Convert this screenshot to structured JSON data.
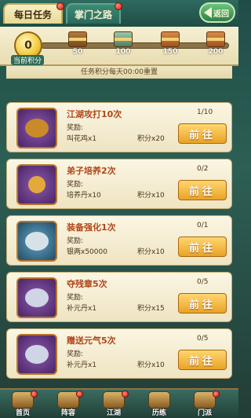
{
  "tabs": [
    {
      "label": "每日任务",
      "active": true
    },
    {
      "label": "掌门之路",
      "active": false
    }
  ],
  "back_label": "返回",
  "points": {
    "current": "0",
    "label": "当前积分",
    "milestones": [
      "50",
      "100",
      "150",
      "200"
    ]
  },
  "notice": "任务积分每天00:00重置",
  "tasks": [
    {
      "title": "江湖攻打10次",
      "reward_label": "奖励:",
      "reward_item": "叫花鸡x1",
      "reward_points": "积分x20",
      "progress": "1/10",
      "button": "前往"
    },
    {
      "title": "弟子培养2次",
      "reward_label": "奖励:",
      "reward_item": "培养丹x10",
      "reward_points": "积分x10",
      "progress": "0/2",
      "button": "前往"
    },
    {
      "title": "装备强化1次",
      "reward_label": "奖励:",
      "reward_item": "银两x50000",
      "reward_points": "积分x10",
      "progress": "0/1",
      "button": "前往"
    },
    {
      "title": "夺残章5次",
      "reward_label": "奖励:",
      "reward_item": "补元丹x1",
      "reward_points": "积分x15",
      "progress": "0/5",
      "button": "前往"
    },
    {
      "title": "赠送元气5次",
      "reward_label": "奖励:",
      "reward_item": "补元丹x1",
      "reward_points": "积分x10",
      "progress": "0/5",
      "button": "前往"
    }
  ],
  "nav": [
    {
      "label": "首页",
      "badge": true
    },
    {
      "label": "阵容",
      "badge": true
    },
    {
      "label": "江湖",
      "badge": true
    },
    {
      "label": "历练",
      "badge": false
    },
    {
      "label": "门派",
      "badge": true
    }
  ],
  "colors": {
    "accent": "#e9a326",
    "title": "#b0461b",
    "badge": "#d11d12"
  }
}
